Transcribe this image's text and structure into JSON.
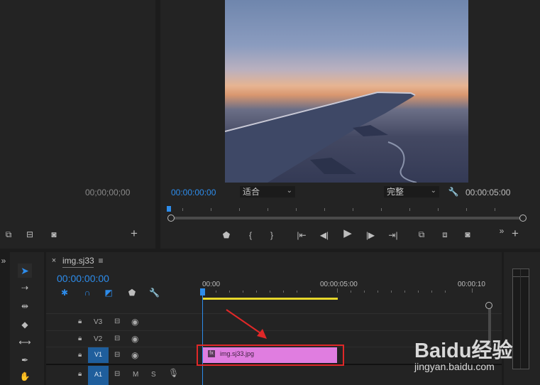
{
  "source_monitor": {
    "timecode": "00;00;00;00"
  },
  "program_monitor": {
    "timecode": "00:00:00:00",
    "fit_label": "适合",
    "quality_label": "完整",
    "duration": "00:00:05:00"
  },
  "timeline": {
    "sequence_name": "img.sj33",
    "timecode": "00:00:00:00",
    "ruler": [
      "00:00",
      "00:00:05:00",
      "00:00:10"
    ],
    "tracks": [
      "V3",
      "V2",
      "V1",
      "A1"
    ],
    "audio_buttons": {
      "mute": "M",
      "solo": "S"
    },
    "clip_name": "img.sj33.jpg"
  },
  "watermark": {
    "brand": "Baidu经验",
    "url": "jingyan.baidu.com"
  },
  "colors": {
    "accent": "#2d8ceb",
    "clip": "#e07de0",
    "highlight_box": "#e02828",
    "work_area": "#e6d62a"
  }
}
